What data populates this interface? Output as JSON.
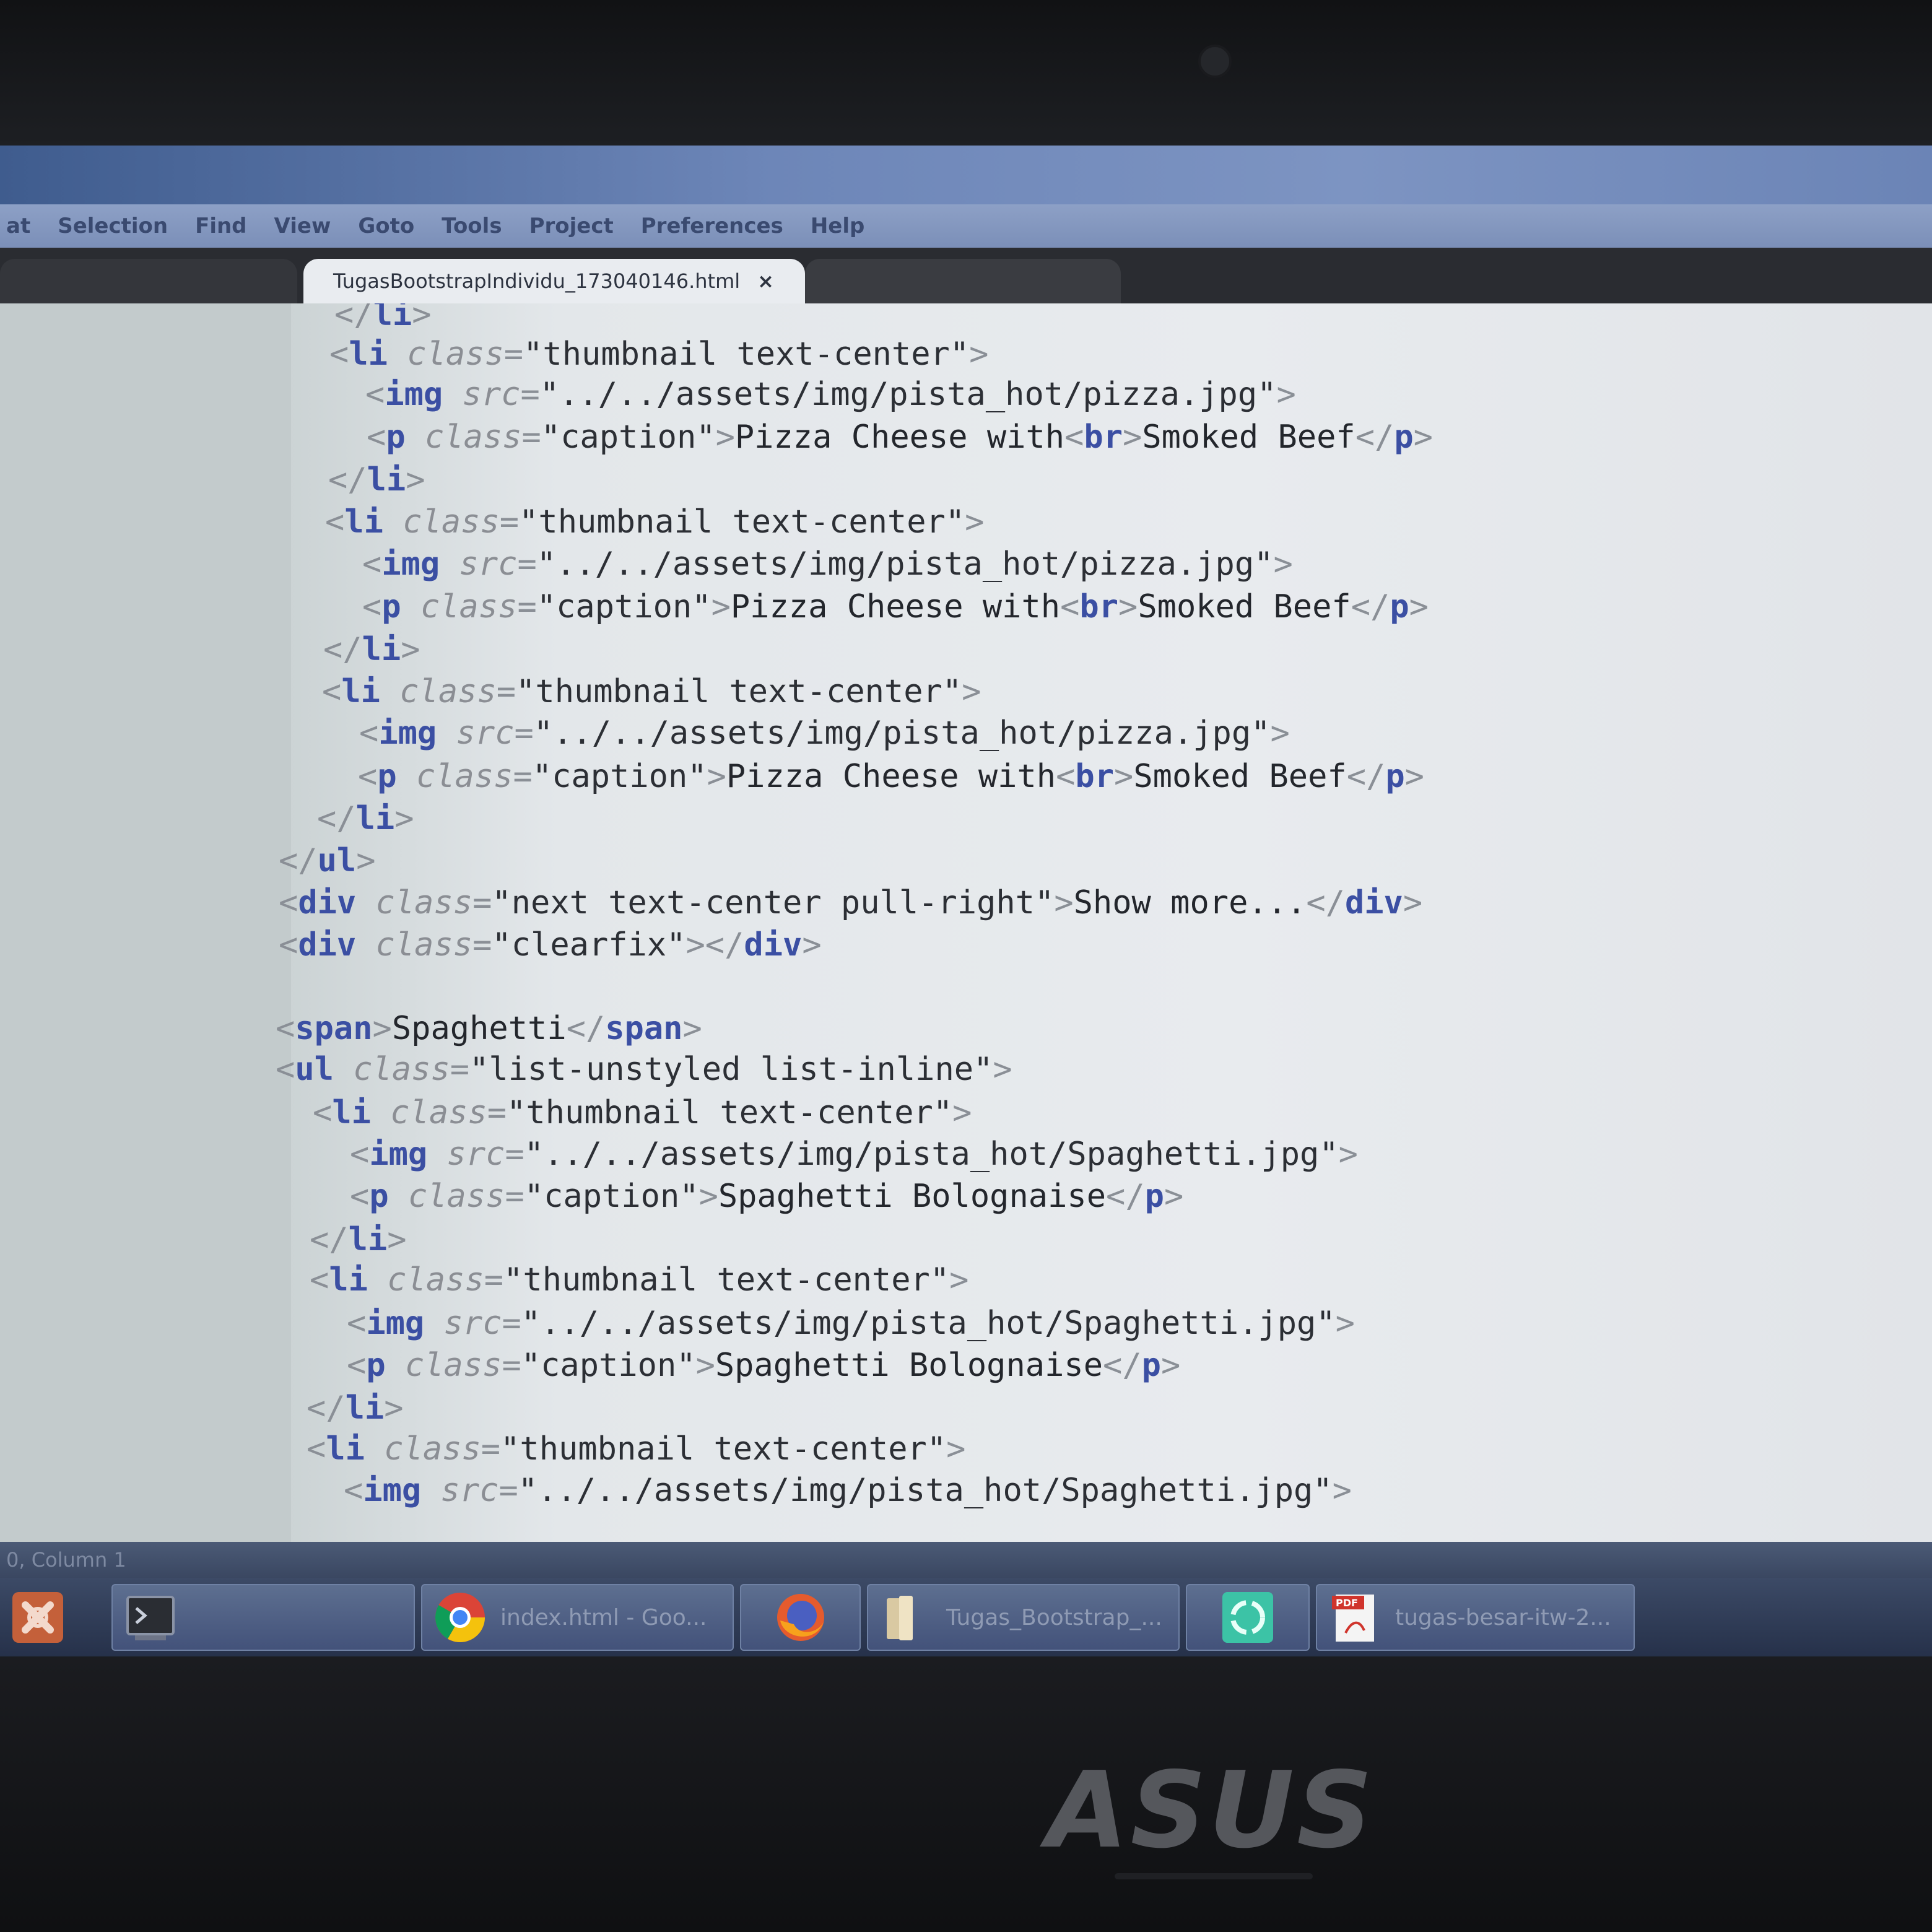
{
  "window": {
    "title": "",
    "menu": [
      "at",
      "Selection",
      "Find",
      "View",
      "Goto",
      "Tools",
      "Project",
      "Preferences",
      "Help"
    ]
  },
  "tabs": {
    "active_label": "TugasBootstrapIndividu_173040146.html",
    "close_glyph": "×"
  },
  "code_lines": [
    [
      [
        "p",
        "</"
      ],
      [
        "t",
        "li"
      ],
      [
        "p",
        ">"
      ]
    ],
    [
      [
        "p",
        "<"
      ],
      [
        "t",
        "li"
      ],
      [
        "s",
        " "
      ],
      [
        "a",
        "class"
      ],
      [
        "p",
        "="
      ],
      [
        "s",
        "\"thumbnail text-center\""
      ],
      [
        "p",
        ">"
      ]
    ],
    [
      [
        "p",
        "<"
      ],
      [
        "t",
        "img"
      ],
      [
        "s",
        " "
      ],
      [
        "a",
        "src"
      ],
      [
        "p",
        "="
      ],
      [
        "s",
        "\"../../assets/img/pista_hot/pizza.jpg\""
      ],
      [
        "p",
        ">"
      ]
    ],
    [
      [
        "p",
        "<"
      ],
      [
        "t",
        "p"
      ],
      [
        "s",
        " "
      ],
      [
        "a",
        "class"
      ],
      [
        "p",
        "="
      ],
      [
        "s",
        "\"caption\""
      ],
      [
        "p",
        ">"
      ],
      [
        "x",
        "Pizza Cheese with"
      ],
      [
        "p",
        "<"
      ],
      [
        "t",
        "br"
      ],
      [
        "p",
        ">"
      ],
      [
        "x",
        "Smoked Beef"
      ],
      [
        "p",
        "</"
      ],
      [
        "t",
        "p"
      ],
      [
        "p",
        ">"
      ]
    ],
    [
      [
        "p",
        "</"
      ],
      [
        "t",
        "li"
      ],
      [
        "p",
        ">"
      ]
    ],
    [
      [
        "p",
        "<"
      ],
      [
        "t",
        "li"
      ],
      [
        "s",
        " "
      ],
      [
        "a",
        "class"
      ],
      [
        "p",
        "="
      ],
      [
        "s",
        "\"thumbnail text-center\""
      ],
      [
        "p",
        ">"
      ]
    ],
    [
      [
        "p",
        "<"
      ],
      [
        "t",
        "img"
      ],
      [
        "s",
        " "
      ],
      [
        "a",
        "src"
      ],
      [
        "p",
        "="
      ],
      [
        "s",
        "\"../../assets/img/pista_hot/pizza.jpg\""
      ],
      [
        "p",
        ">"
      ]
    ],
    [
      [
        "p",
        "<"
      ],
      [
        "t",
        "p"
      ],
      [
        "s",
        " "
      ],
      [
        "a",
        "class"
      ],
      [
        "p",
        "="
      ],
      [
        "s",
        "\"caption\""
      ],
      [
        "p",
        ">"
      ],
      [
        "x",
        "Pizza Cheese with"
      ],
      [
        "p",
        "<"
      ],
      [
        "t",
        "br"
      ],
      [
        "p",
        ">"
      ],
      [
        "x",
        "Smoked Beef"
      ],
      [
        "p",
        "</"
      ],
      [
        "t",
        "p"
      ],
      [
        "p",
        ">"
      ]
    ],
    [
      [
        "p",
        "</"
      ],
      [
        "t",
        "li"
      ],
      [
        "p",
        ">"
      ]
    ],
    [
      [
        "p",
        "<"
      ],
      [
        "t",
        "li"
      ],
      [
        "s",
        " "
      ],
      [
        "a",
        "class"
      ],
      [
        "p",
        "="
      ],
      [
        "s",
        "\"thumbnail text-center\""
      ],
      [
        "p",
        ">"
      ]
    ],
    [
      [
        "p",
        "<"
      ],
      [
        "t",
        "img"
      ],
      [
        "s",
        " "
      ],
      [
        "a",
        "src"
      ],
      [
        "p",
        "="
      ],
      [
        "s",
        "\"../../assets/img/pista_hot/pizza.jpg\""
      ],
      [
        "p",
        ">"
      ]
    ],
    [
      [
        "p",
        "<"
      ],
      [
        "t",
        "p"
      ],
      [
        "s",
        " "
      ],
      [
        "a",
        "class"
      ],
      [
        "p",
        "="
      ],
      [
        "s",
        "\"caption\""
      ],
      [
        "p",
        ">"
      ],
      [
        "x",
        "Pizza Cheese with"
      ],
      [
        "p",
        "<"
      ],
      [
        "t",
        "br"
      ],
      [
        "p",
        ">"
      ],
      [
        "x",
        "Smoked Beef"
      ],
      [
        "p",
        "</"
      ],
      [
        "t",
        "p"
      ],
      [
        "p",
        ">"
      ]
    ],
    [
      [
        "p",
        "</"
      ],
      [
        "t",
        "li"
      ],
      [
        "p",
        ">"
      ]
    ],
    [
      [
        "p",
        "</"
      ],
      [
        "t",
        "ul"
      ],
      [
        "p",
        ">"
      ]
    ],
    [
      [
        "p",
        "<"
      ],
      [
        "t",
        "div"
      ],
      [
        "s",
        " "
      ],
      [
        "a",
        "class"
      ],
      [
        "p",
        "="
      ],
      [
        "s",
        "\"next text-center pull-right\""
      ],
      [
        "p",
        ">"
      ],
      [
        "x",
        "Show more..."
      ],
      [
        "p",
        "</"
      ],
      [
        "t",
        "div"
      ],
      [
        "p",
        ">"
      ]
    ],
    [
      [
        "p",
        "<"
      ],
      [
        "t",
        "div"
      ],
      [
        "s",
        " "
      ],
      [
        "a",
        "class"
      ],
      [
        "p",
        "="
      ],
      [
        "s",
        "\"clearfix\""
      ],
      [
        "p",
        "></"
      ],
      [
        "t",
        "div"
      ],
      [
        "p",
        ">"
      ]
    ],
    [],
    [
      [
        "p",
        "<"
      ],
      [
        "t",
        "span"
      ],
      [
        "p",
        ">"
      ],
      [
        "x",
        "Spaghetti"
      ],
      [
        "p",
        "</"
      ],
      [
        "t",
        "span"
      ],
      [
        "p",
        ">"
      ]
    ],
    [
      [
        "p",
        "<"
      ],
      [
        "t",
        "ul"
      ],
      [
        "s",
        " "
      ],
      [
        "a",
        "class"
      ],
      [
        "p",
        "="
      ],
      [
        "s",
        "\"list-unstyled list-inline\""
      ],
      [
        "p",
        ">"
      ]
    ],
    [
      [
        "p",
        "<"
      ],
      [
        "t",
        "li"
      ],
      [
        "s",
        " "
      ],
      [
        "a",
        "class"
      ],
      [
        "p",
        "="
      ],
      [
        "s",
        "\"thumbnail text-center\""
      ],
      [
        "p",
        ">"
      ]
    ],
    [
      [
        "p",
        "<"
      ],
      [
        "t",
        "img"
      ],
      [
        "s",
        " "
      ],
      [
        "a",
        "src"
      ],
      [
        "p",
        "="
      ],
      [
        "s",
        "\"../../assets/img/pista_hot/Spaghetti.jpg\""
      ],
      [
        "p",
        ">"
      ]
    ],
    [
      [
        "p",
        "<"
      ],
      [
        "t",
        "p"
      ],
      [
        "s",
        " "
      ],
      [
        "a",
        "class"
      ],
      [
        "p",
        "="
      ],
      [
        "s",
        "\"caption\""
      ],
      [
        "p",
        ">"
      ],
      [
        "x",
        "Spaghetti Bolognaise"
      ],
      [
        "p",
        "</"
      ],
      [
        "t",
        "p"
      ],
      [
        "p",
        ">"
      ]
    ],
    [
      [
        "p",
        "</"
      ],
      [
        "t",
        "li"
      ],
      [
        "p",
        ">"
      ]
    ],
    [
      [
        "p",
        "<"
      ],
      [
        "t",
        "li"
      ],
      [
        "s",
        " "
      ],
      [
        "a",
        "class"
      ],
      [
        "p",
        "="
      ],
      [
        "s",
        "\"thumbnail text-center\""
      ],
      [
        "p",
        ">"
      ]
    ],
    [
      [
        "p",
        "<"
      ],
      [
        "t",
        "img"
      ],
      [
        "s",
        " "
      ],
      [
        "a",
        "src"
      ],
      [
        "p",
        "="
      ],
      [
        "s",
        "\"../../assets/img/pista_hot/Spaghetti.jpg\""
      ],
      [
        "p",
        ">"
      ]
    ],
    [
      [
        "p",
        "<"
      ],
      [
        "t",
        "p"
      ],
      [
        "s",
        " "
      ],
      [
        "a",
        "class"
      ],
      [
        "p",
        "="
      ],
      [
        "s",
        "\"caption\""
      ],
      [
        "p",
        ">"
      ],
      [
        "x",
        "Spaghetti Bolognaise"
      ],
      [
        "p",
        "</"
      ],
      [
        "t",
        "p"
      ],
      [
        "p",
        ">"
      ]
    ],
    [
      [
        "p",
        "</"
      ],
      [
        "t",
        "li"
      ],
      [
        "p",
        ">"
      ]
    ],
    [
      [
        "p",
        "<"
      ],
      [
        "t",
        "li"
      ],
      [
        "s",
        " "
      ],
      [
        "a",
        "class"
      ],
      [
        "p",
        "="
      ],
      [
        "s",
        "\"thumbnail text-center\""
      ],
      [
        "p",
        ">"
      ]
    ],
    [
      [
        "p",
        "<"
      ],
      [
        "t",
        "img"
      ],
      [
        "s",
        " "
      ],
      [
        "a",
        "src"
      ],
      [
        "p",
        "="
      ],
      [
        "s",
        "\"../../assets/img/pista_hot/Spaghetti.jpg\""
      ],
      [
        "p",
        ">"
      ]
    ]
  ],
  "status": {
    "text": "0, Column 1"
  },
  "taskbar": {
    "items": [
      {
        "name": "xampp",
        "label": "",
        "icon": "xampp-icon"
      },
      {
        "name": "terminal",
        "label": "",
        "icon": "terminal-icon"
      },
      {
        "name": "chrome",
        "label": "index.html - Goo...",
        "icon": "chrome-icon"
      },
      {
        "name": "firefox",
        "label": "",
        "icon": "firefox-icon"
      },
      {
        "name": "folder",
        "label": "Tugas_Bootstrap_...",
        "icon": "folder-icon"
      },
      {
        "name": "recycle",
        "label": "",
        "icon": "recycle-icon"
      },
      {
        "name": "pdf",
        "label": "tugas-besar-itw-2...",
        "icon": "pdf-icon"
      }
    ]
  },
  "hardware": {
    "brand": "ASUS"
  },
  "colors": {
    "tag": "#3b4fa3",
    "attribute": "#8b8e94",
    "string": "#2c2f35",
    "text": "#23262c",
    "punctuation": "#8a8f96"
  }
}
